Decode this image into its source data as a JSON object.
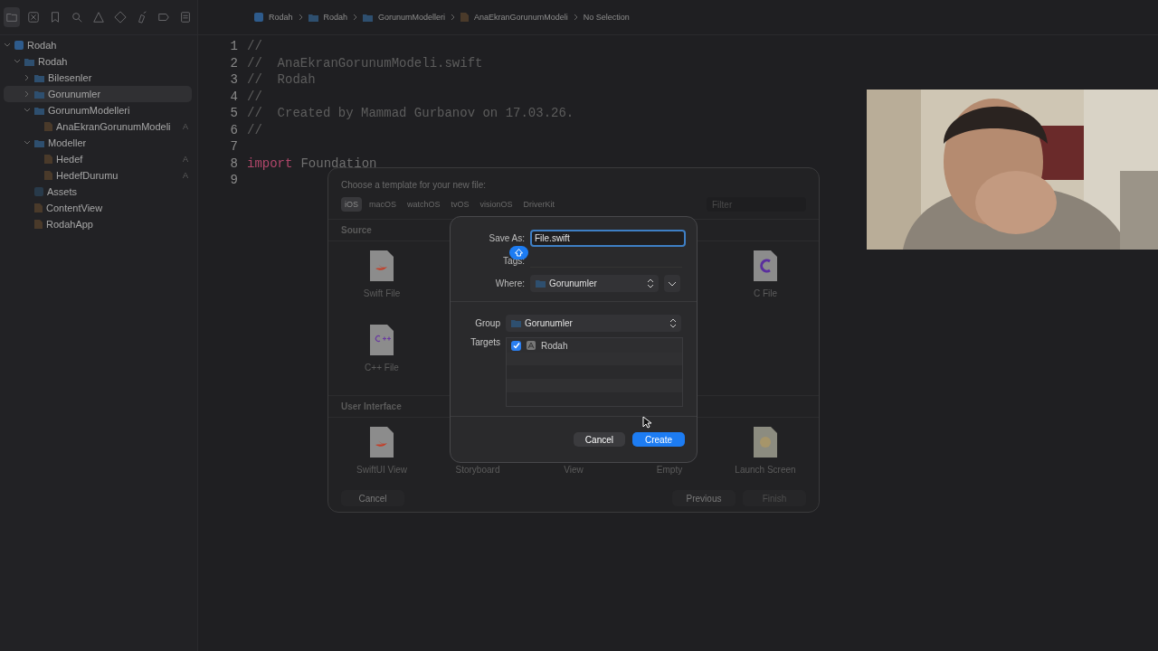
{
  "sidebar": {
    "toolbar_icons": [
      {
        "kind": "folder",
        "selected": true
      },
      {
        "kind": "issues",
        "selected": false
      },
      {
        "kind": "bookmark",
        "selected": false
      },
      {
        "kind": "search",
        "selected": false
      },
      {
        "kind": "warning",
        "selected": false
      },
      {
        "kind": "diamond",
        "selected": false
      },
      {
        "kind": "spray",
        "selected": false
      },
      {
        "kind": "label",
        "selected": false
      },
      {
        "kind": "list",
        "selected": false
      }
    ],
    "tree": [
      {
        "label": "Rodah",
        "kind": "project",
        "expanded": true,
        "selected": false,
        "children": [
          {
            "label": "Rodah",
            "kind": "folder",
            "expanded": true,
            "selected": false,
            "children": [
              {
                "label": "Bilesenler",
                "kind": "folder",
                "expanded": false,
                "selected": false
              },
              {
                "label": "Gorunumler",
                "kind": "folder",
                "expanded": false,
                "selected": true
              },
              {
                "label": "GorunumModelleri",
                "kind": "folder",
                "expanded": true,
                "selected": false,
                "children": [
                  {
                    "label": "AnaEkranGorunumModeli",
                    "kind": "swift",
                    "badge": "A",
                    "selected": false
                  }
                ]
              },
              {
                "label": "Modeller",
                "kind": "folder",
                "expanded": true,
                "selected": false,
                "children": [
                  {
                    "label": "Hedef",
                    "kind": "swift",
                    "badge": "A",
                    "selected": false
                  },
                  {
                    "label": "HedefDurumu",
                    "kind": "swift",
                    "badge": "A",
                    "selected": false
                  }
                ]
              },
              {
                "label": "Assets",
                "kind": "assets",
                "selected": false
              },
              {
                "label": "ContentView",
                "kind": "swift",
                "selected": false
              },
              {
                "label": "RodahApp",
                "kind": "swift",
                "selected": false
              }
            ]
          }
        ]
      }
    ]
  },
  "breadcrumb": [
    {
      "label": "Rodah",
      "kind": "project"
    },
    {
      "label": "Rodah",
      "kind": "folder"
    },
    {
      "label": "GorunumModelleri",
      "kind": "folder"
    },
    {
      "label": "AnaEkranGorunumModeli",
      "kind": "swift"
    },
    {
      "label": "No Selection",
      "kind": "text"
    }
  ],
  "code_lines": [
    {
      "number": "1",
      "text": "//",
      "kind": "comment"
    },
    {
      "number": "2",
      "text": "//  AnaEkranGorunumModeli.swift",
      "kind": "comment"
    },
    {
      "number": "3",
      "text": "//  Rodah",
      "kind": "comment"
    },
    {
      "number": "4",
      "text": "//",
      "kind": "comment"
    },
    {
      "number": "5",
      "text": "//  Created by Mammad Gurbanov on 17.03.26.",
      "kind": "comment"
    },
    {
      "number": "6",
      "text": "//",
      "kind": "comment"
    },
    {
      "number": "7",
      "kind": "blank"
    },
    {
      "number": "8",
      "keyword": "import",
      "text": "Foundation",
      "kind": "import"
    },
    {
      "number": "9",
      "kind": "blank"
    }
  ],
  "template_sheet": {
    "title": "Choose a template for your new file:",
    "platforms": [
      {
        "label": "iOS",
        "selected": true
      },
      {
        "label": "macOS",
        "selected": false
      },
      {
        "label": "watchOS",
        "selected": false
      },
      {
        "label": "tvOS",
        "selected": false
      },
      {
        "label": "visionOS",
        "selected": false
      },
      {
        "label": "DriverKit",
        "selected": false
      }
    ],
    "filter": {
      "placeholder": "Filter"
    },
    "sections": [
      {
        "title": "Source",
        "rows": [
          [
            {
              "label": "Swift File",
              "kind": "swift"
            },
            null,
            null,
            null,
            {
              "label": "C File",
              "kind": "c"
            }
          ],
          [
            {
              "label": "C++ File",
              "kind": "cpp"
            },
            null,
            null,
            null,
            null
          ]
        ]
      },
      {
        "title": "User Interface",
        "rows": [
          [
            {
              "label": "SwiftUI View",
              "kind": "swift"
            },
            {
              "label": "Storyboard",
              "kind": "hidden"
            },
            {
              "label": "View",
              "kind": "hidden"
            },
            {
              "label": "Empty",
              "kind": "hidden"
            },
            {
              "label": "Launch Screen",
              "kind": "launch"
            }
          ]
        ]
      }
    ],
    "buttons": [
      {
        "label": "Cancel",
        "disabled": false
      },
      {
        "label": "Previous",
        "disabled": false
      },
      {
        "label": "Finish",
        "disabled": true
      }
    ]
  },
  "save_dialog": {
    "save_as": {
      "label": "Save As:",
      "value": "File.swift"
    },
    "tags": {
      "label": "Tags:"
    },
    "where": {
      "label": "Where:",
      "value": "Gorunumler"
    },
    "group": {
      "label": "Group",
      "value": "Gorunumler"
    },
    "targets": {
      "label": "Targets",
      "items": [
        {
          "label": "Rodah",
          "checked": true
        }
      ]
    },
    "buttons": [
      {
        "label": "Cancel",
        "kind": "secondary"
      },
      {
        "label": "Create",
        "kind": "primary"
      }
    ]
  }
}
